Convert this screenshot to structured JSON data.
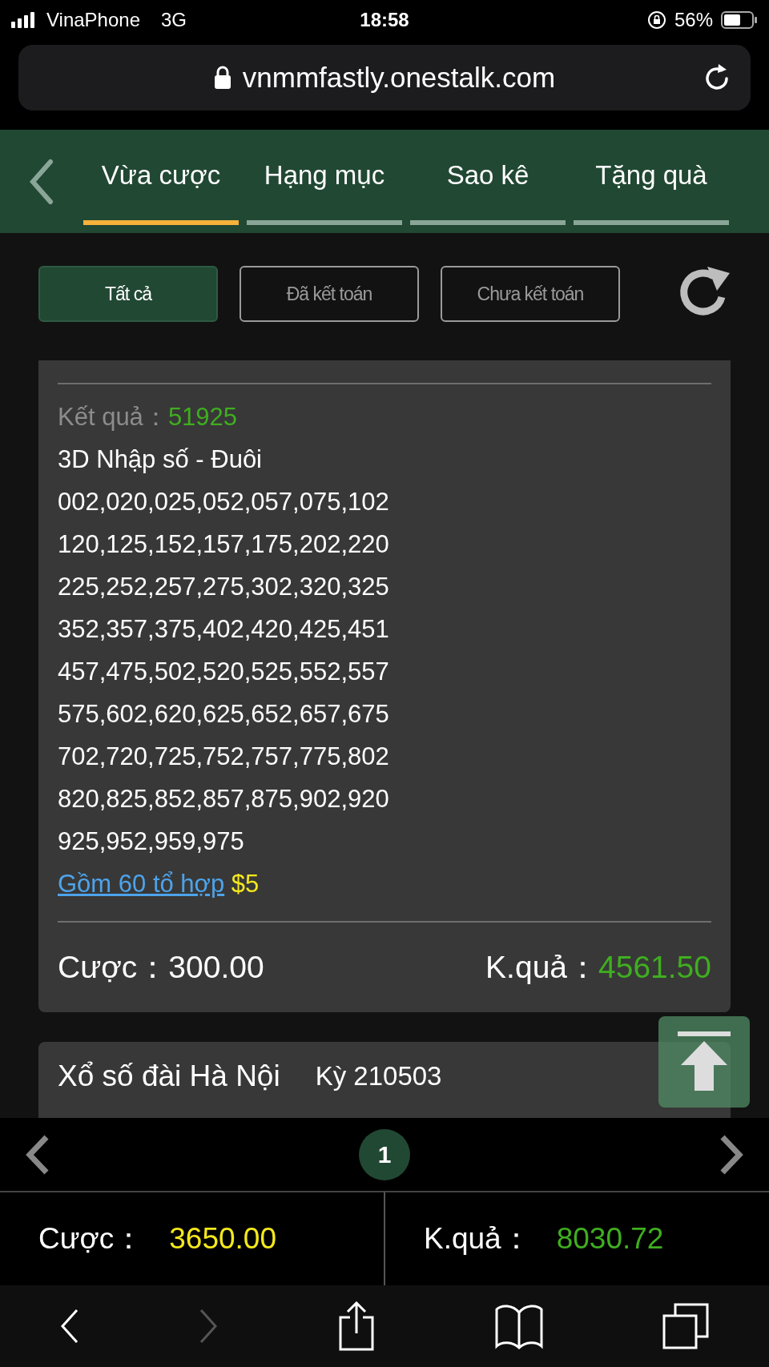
{
  "status_bar": {
    "carrier": "VinaPhone",
    "network": "3G",
    "time": "18:58",
    "battery": "56%"
  },
  "address_bar": {
    "url": "vnmmfastly.onestalk.com"
  },
  "tabs": [
    {
      "label": "Vừa cược",
      "selected": true
    },
    {
      "label": "Hạng mục",
      "selected": false
    },
    {
      "label": "Sao kê",
      "selected": false
    },
    {
      "label": "Tặng quà",
      "selected": false
    }
  ],
  "filters": [
    {
      "label": "Tất cả",
      "selected": true
    },
    {
      "label": "Đã kết toán",
      "selected": false
    },
    {
      "label": "Chưa kết toán",
      "selected": false
    }
  ],
  "bet_detail": {
    "result_label": "Kết quả：",
    "result": "51925",
    "bet_type": "3D Nhập số - Đuôi",
    "numbers": [
      "002,020,025,052,057,075,102",
      "120,125,152,157,175,202,220",
      "225,252,257,275,302,320,325",
      "352,357,375,402,420,425,451",
      "457,475,502,520,525,552,557",
      "575,602,620,625,652,657,675",
      "702,720,725,752,757,775,802",
      "820,825,852,857,875,902,920",
      "925,952,959,975"
    ],
    "combo_link": "Gồm 60 tổ hợp",
    "unit": "$5",
    "stake_label": "Cược：",
    "stake": "300.00",
    "payout_label": "K.quả：",
    "payout": "4561.50"
  },
  "next_bet": {
    "title": "Xổ số đài Hà Nội",
    "period": "Kỳ 210503"
  },
  "pagination": {
    "pages": [
      {
        "label": "1",
        "selected": true
      }
    ]
  },
  "totals": {
    "stake_label": "Cược：",
    "stake": "3650.00",
    "payout_label": "K.quả：",
    "payout": "8030.72"
  },
  "browser_toolbar": {
    "forward_disabled": true
  }
}
